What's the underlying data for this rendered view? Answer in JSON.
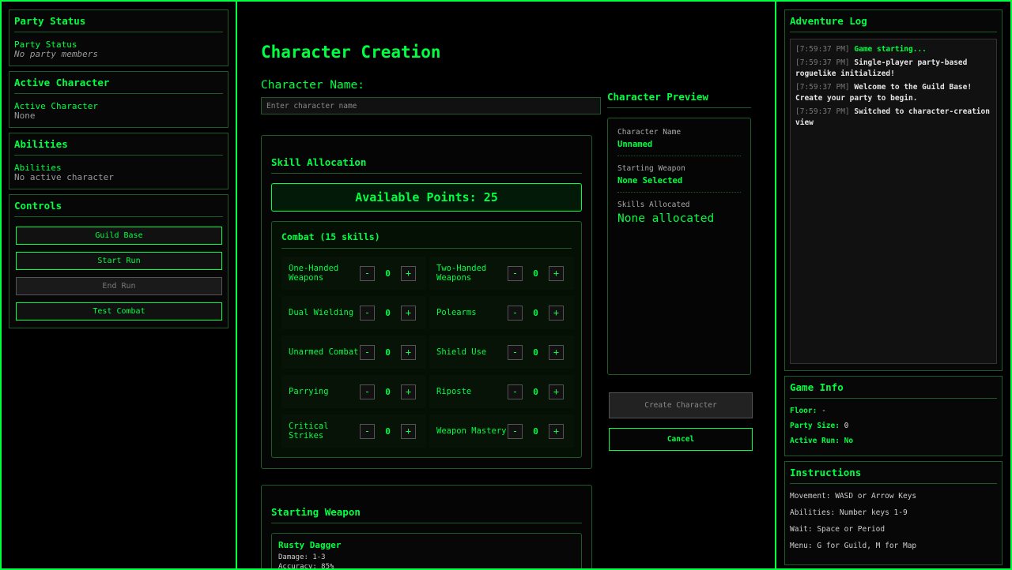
{
  "left": {
    "party": {
      "title": "Party Status",
      "label": "Party Status",
      "value": "No party members"
    },
    "active": {
      "title": "Active Character",
      "label": "Active Character",
      "value": "None"
    },
    "abilities": {
      "title": "Abilities",
      "label": "Abilities",
      "value": "No active character"
    },
    "controls": {
      "title": "Controls",
      "buttons": [
        "Guild Base",
        "Start Run",
        "End Run",
        "Test Combat"
      ]
    }
  },
  "center": {
    "title": "Character Creation",
    "name_label": "Character Name:",
    "name_placeholder": "Enter character name",
    "skills": {
      "title": "Skill Allocation",
      "points_label": "Available Points: 25",
      "category": "Combat (15 skills)",
      "minus": "-",
      "plus": "+",
      "items": [
        {
          "name": "One-Handed Weapons",
          "value": "0"
        },
        {
          "name": "Two-Handed Weapons",
          "value": "0"
        },
        {
          "name": "Dual Wielding",
          "value": "0"
        },
        {
          "name": "Polearms",
          "value": "0"
        },
        {
          "name": "Unarmed Combat",
          "value": "0"
        },
        {
          "name": "Shield Use",
          "value": "0"
        },
        {
          "name": "Parrying",
          "value": "0"
        },
        {
          "name": "Riposte",
          "value": "0"
        },
        {
          "name": "Critical Strikes",
          "value": "0"
        },
        {
          "name": "Weapon Mastery",
          "value": "0"
        }
      ]
    },
    "preview": {
      "title": "Character Preview",
      "name_label": "Character Name",
      "name_value": "Unnamed",
      "weapon_label": "Starting Weapon",
      "weapon_value": "None Selected",
      "skills_label": "Skills Allocated",
      "skills_value": "None allocated"
    },
    "create_label": "Create Character",
    "cancel_label": "Cancel",
    "weapon": {
      "title": "Starting Weapon",
      "name": "Rusty Dagger",
      "damage": "Damage: 1-3",
      "accuracy": "Accuracy: 85%"
    }
  },
  "right": {
    "log": {
      "title": "Adventure Log",
      "entries": [
        {
          "time": "[7:59:37 PM]",
          "text": "Game starting..."
        },
        {
          "time": "[7:59:37 PM]",
          "text": "Single-player party-based roguelike initialized!"
        },
        {
          "time": "[7:59:37 PM]",
          "text": "Welcome to the Guild Base! Create your party to begin."
        },
        {
          "time": "[7:59:37 PM]",
          "text": "Switched to character-creation view"
        }
      ]
    },
    "game_info": {
      "title": "Game Info",
      "floor_label": "Floor:",
      "floor_value": "-",
      "party_label": "Party Size:",
      "party_value": "0",
      "run_label": "Active Run:",
      "run_value": "No"
    },
    "instructions": {
      "title": "Instructions",
      "lines": [
        "Movement: WASD or Arrow Keys",
        "Abilities: Number keys 1-9",
        "Wait: Space or Period",
        "Menu: G for Guild, M for Map"
      ]
    }
  },
  "colors": {
    "accent": "#00ff41",
    "background": "#000000",
    "border": "#1f5a2a"
  }
}
